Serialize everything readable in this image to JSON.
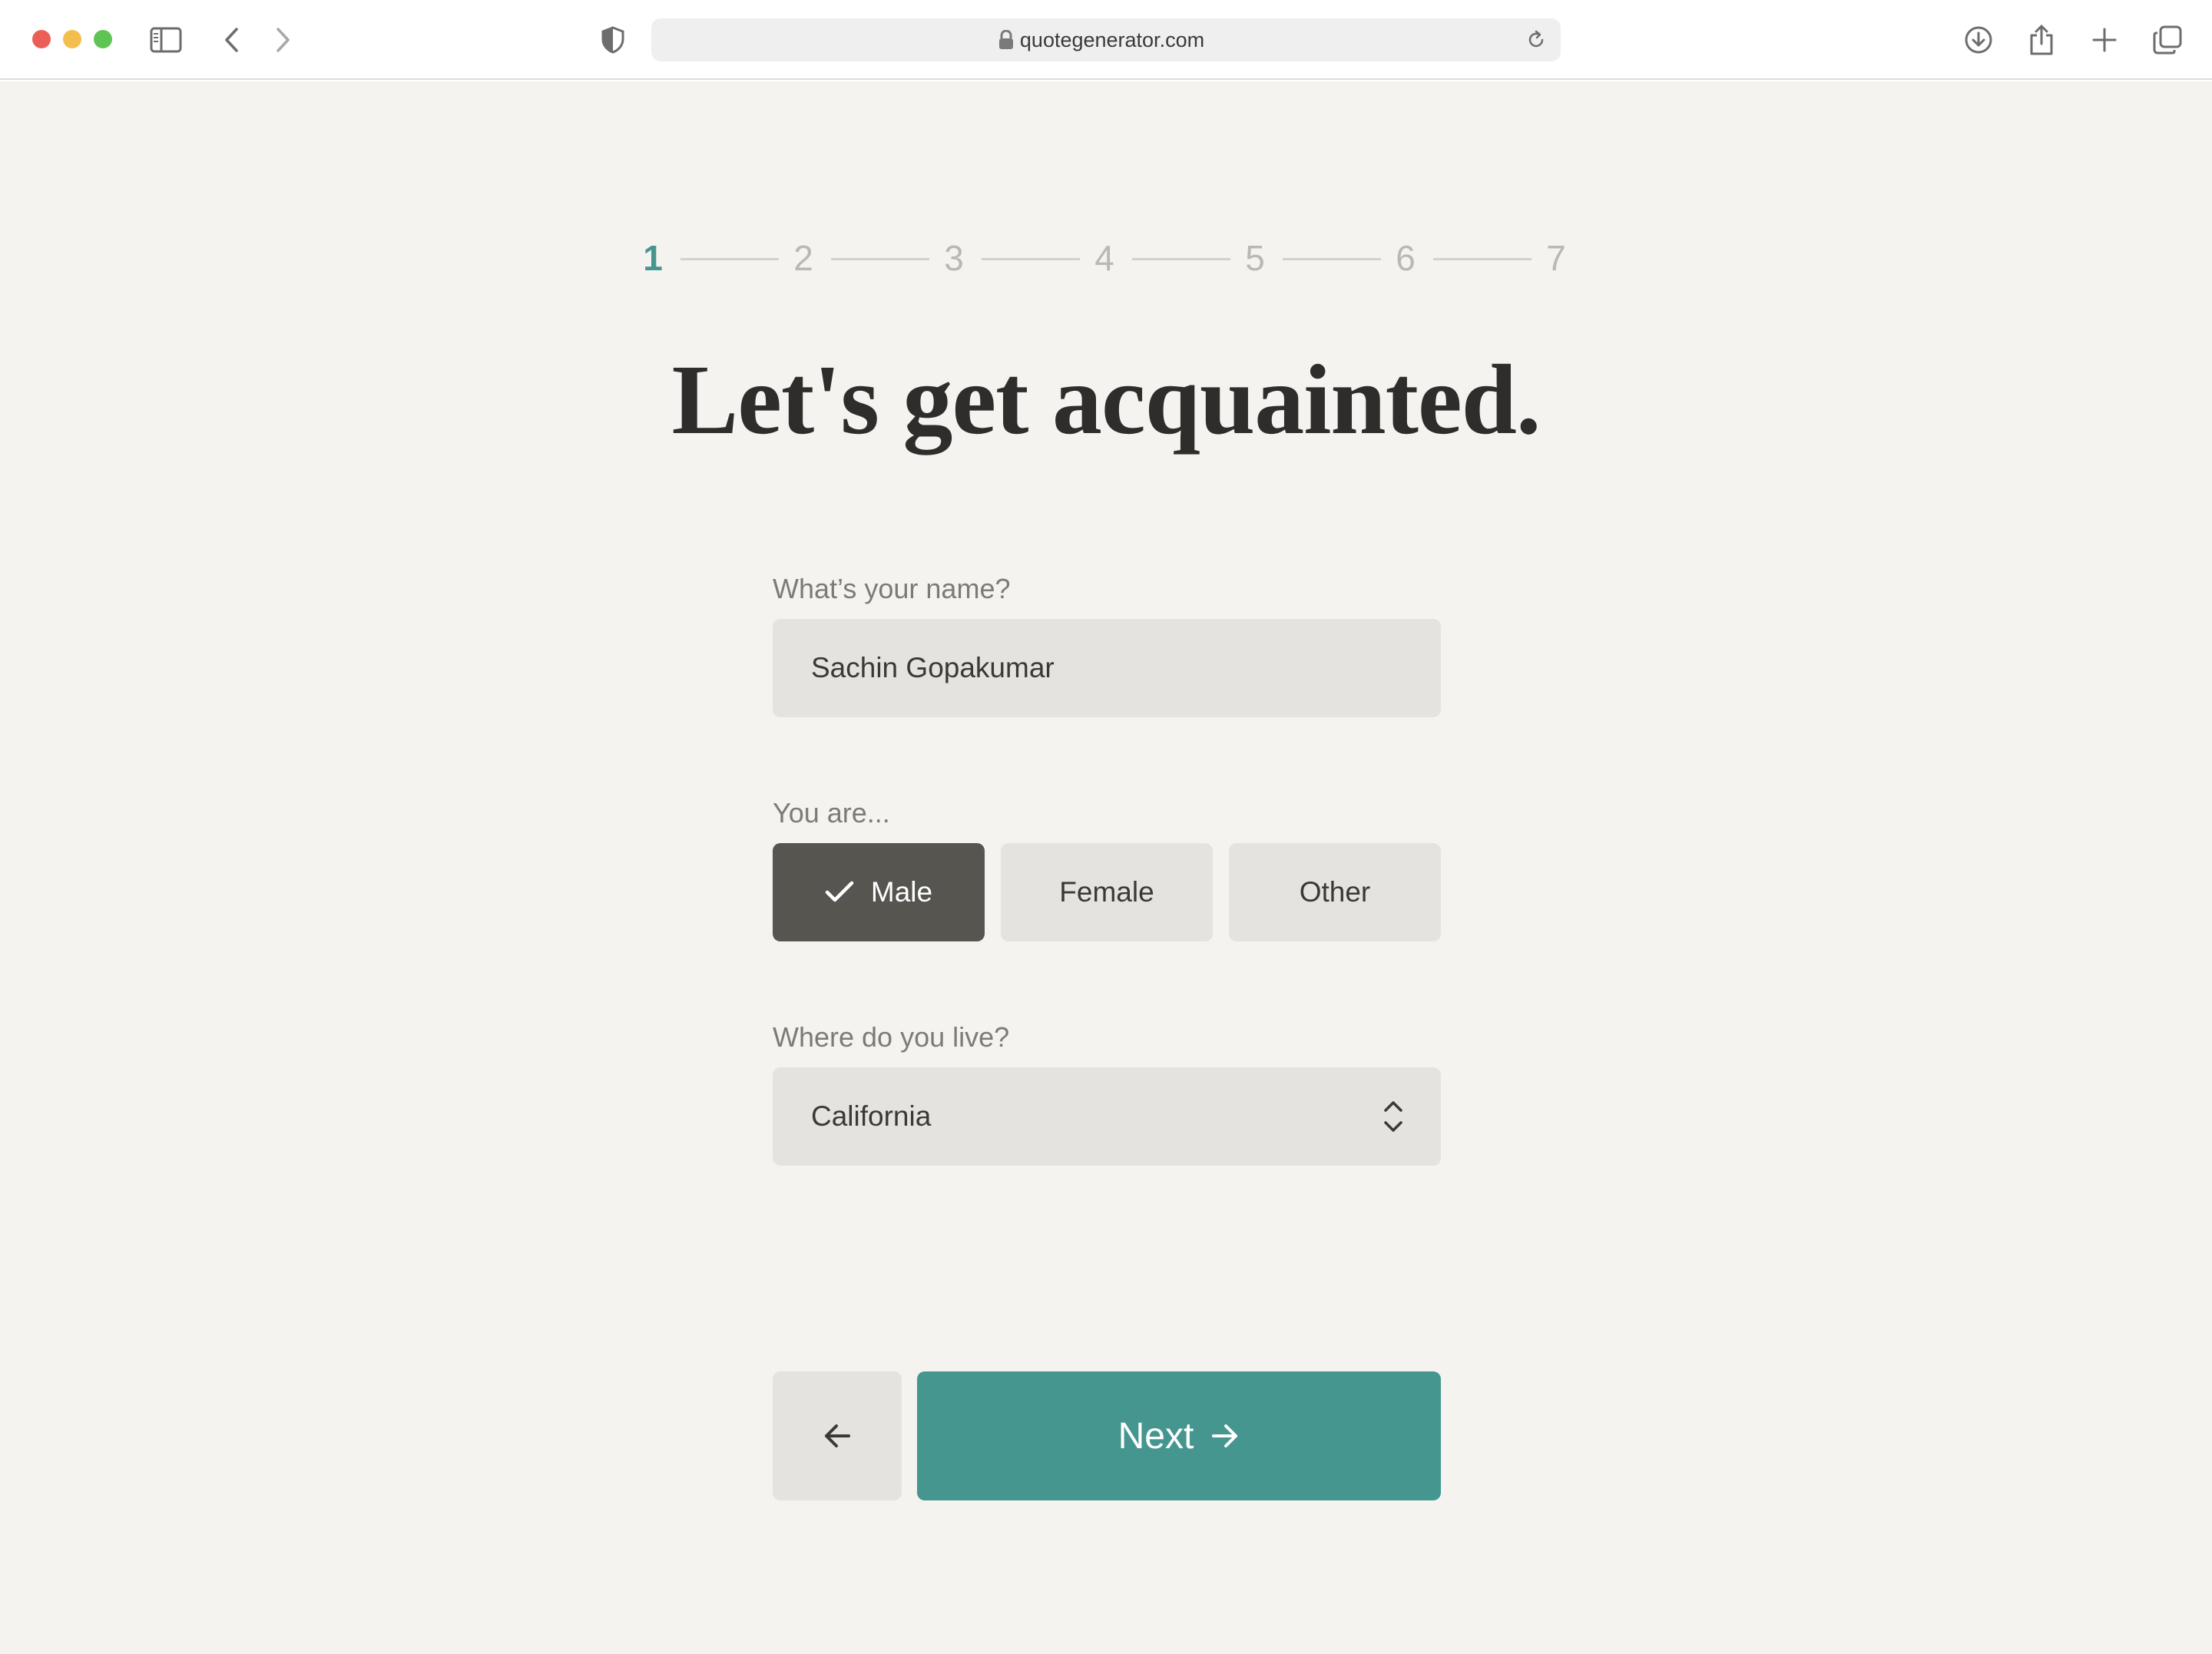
{
  "browser": {
    "url": "quotegenerator.com"
  },
  "stepper": {
    "steps": [
      "1",
      "2",
      "3",
      "4",
      "5",
      "6",
      "7"
    ],
    "current": 1
  },
  "page": {
    "title": "Let's get acquainted."
  },
  "form": {
    "name_label": "What’s your name?",
    "name_value": "Sachin Gopakumar",
    "gender_label": "You are...",
    "gender_options": [
      "Male",
      "Female",
      "Other"
    ],
    "gender_selected": "Male",
    "location_label": "Where do you live?",
    "location_value": "California"
  },
  "nav": {
    "next_label": "Next"
  },
  "colors": {
    "accent": "#469690",
    "selected": "#565550",
    "background": "#f4f3ef",
    "field": "#e4e3df"
  },
  "icons": {
    "sidebar": "sidebar-icon",
    "back": "chevron-left-icon",
    "forward": "chevron-right-icon",
    "shield": "shield-icon",
    "lock": "lock-icon",
    "reload": "reload-icon",
    "download": "download-icon",
    "share": "share-icon",
    "new_tab": "plus-icon",
    "tabs": "tabs-overview-icon",
    "check": "check-icon",
    "select": "updown-chevron-icon",
    "prev": "arrow-left-icon",
    "next": "arrow-right-icon"
  }
}
